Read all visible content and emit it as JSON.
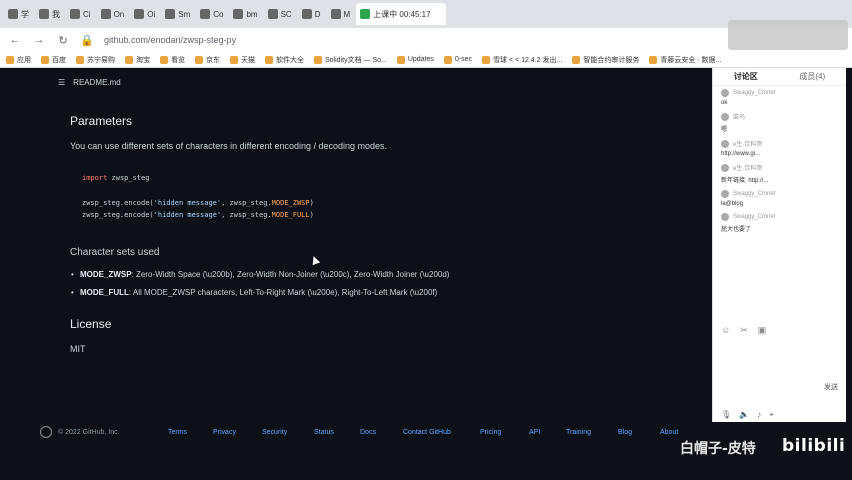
{
  "browser": {
    "tabs": [
      {
        "label": "学"
      },
      {
        "label": "我"
      },
      {
        "label": "Ci"
      },
      {
        "label": "On"
      },
      {
        "label": "Oi"
      },
      {
        "label": "Sm"
      },
      {
        "label": "Co"
      },
      {
        "label": "bm"
      },
      {
        "label": "SC"
      },
      {
        "label": "D"
      },
      {
        "label": "M"
      },
      {
        "label": "上课中 00:45:17"
      }
    ],
    "url": "github.com/enodari/zwsp-steg-py",
    "bookmarks": [
      {
        "label": "应用"
      },
      {
        "label": "百度"
      },
      {
        "label": "苏宁易购"
      },
      {
        "label": "淘宝"
      },
      {
        "label": "看览"
      },
      {
        "label": "京东"
      },
      {
        "label": "天猫"
      },
      {
        "label": "软件大全"
      },
      {
        "label": "Solidity文档 — So..."
      },
      {
        "label": "Updates"
      },
      {
        "label": "0-sec"
      },
      {
        "label": "雪球 < < 12.4.2 发出..."
      },
      {
        "label": "智能合约审计服务"
      },
      {
        "label": "青藤云安全 · 数据..."
      }
    ]
  },
  "readme": {
    "filename": "README.md",
    "parameters_heading": "Parameters",
    "parameters_text": "You can use different sets of characters in different encoding / decoding modes.",
    "code": {
      "line1_kw": "import",
      "line1_rest": " zwsp_steg",
      "line2_pre": "zwsp_steg.encode(",
      "line2_str": "'hidden message'",
      "line2_mid": ", zwsp_steg.",
      "line2_mode": "MODE_ZWSP",
      "line2_end": ")",
      "line3_pre": "zwsp_steg.encode(",
      "line3_str": "'hidden message'",
      "line3_mid": ", zwsp_steg.",
      "line3_mode": "MODE_FULL",
      "line3_end": ")"
    },
    "charsets_heading": "Character sets used",
    "charsets": [
      {
        "name": "MODE_ZWSP",
        "desc": ": Zero-Width Space (\\u200b), Zero-Width Non-Joiner (\\u200c), Zero-Width Joiner (\\u200d)"
      },
      {
        "name": "MODE_FULL",
        "desc": ": All MODE_ZWSP characters, Left-To-Right Mark (\\u200e), Right-To-Left Mark (\\u200f)"
      }
    ],
    "license_heading": "License",
    "license_text": "MIT"
  },
  "footer": {
    "copyright": "© 2022 GitHub, Inc.",
    "links": [
      "Terms",
      "Privacy",
      "Security",
      "Status",
      "Docs",
      "Contact GitHub",
      "Pricing",
      "API",
      "Training",
      "Blog",
      "About"
    ]
  },
  "panel": {
    "tab_discussion": "讨论区",
    "tab_members": "成员(4)",
    "messages": [
      {
        "user": "Swaggy_Cmnet",
        "text": "ok"
      },
      {
        "user": "菜鸟",
        "text": "嗯"
      },
      {
        "user": "e生·饮料哥",
        "text": "http://www.gi..."
      },
      {
        "user": "e生·饮料哥",
        "text": "新年链接: http://..."
      },
      {
        "user": "Swaggy_Cmnet",
        "text": "la@blog"
      },
      {
        "user": "Swaggy_Cmnet",
        "text": "屁大也要了"
      }
    ],
    "send_label": "发送"
  },
  "watermark": {
    "text": "白帽子-皮特",
    "brand": "bilibili"
  }
}
